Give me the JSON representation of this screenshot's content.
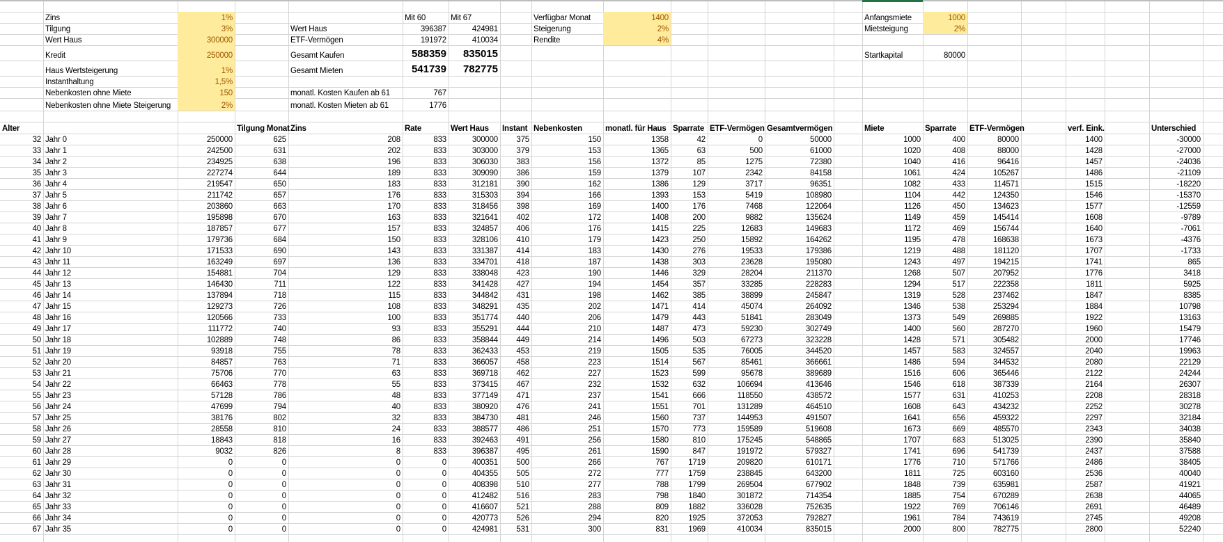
{
  "inputs": {
    "labels": [
      "Zins",
      "Tilgung",
      "Wert Haus",
      "Kredit",
      "Haus Wertsteigerung",
      "Instanthaltung",
      "Nebenkosten ohne Miete",
      "Nebenkosten ohne Miete Steigerung"
    ],
    "values": [
      "1%",
      "3%",
      "300000",
      "250000",
      "1%",
      "1,5%",
      "150",
      "2%"
    ]
  },
  "summary": {
    "col_mit60": "Mit 60",
    "col_mit67": "Mit 67",
    "rows": [
      {
        "label": "Wert Haus",
        "mit60": "396387",
        "mit67": "424981"
      },
      {
        "label": "ETF-Vermögen",
        "mit60": "191972",
        "mit67": "410034"
      },
      {
        "label": "Gesamt Kaufen",
        "mit60": "588359",
        "mit67": "835015"
      },
      {
        "label": "Gesamt Mieten",
        "mit60": "541739",
        "mit67": "782775"
      }
    ],
    "kosten_kaufen_label": "monatl. Kosten Kaufen ab 61",
    "kosten_kaufen": "767",
    "kosten_mieten_label": "monatl. Kosten Mieten ab 61",
    "kosten_mieten": "1776"
  },
  "sparen": {
    "labels": [
      "Verfügbar Monat",
      "Steigerung",
      "Rendite"
    ],
    "values": [
      "1400",
      "2%",
      "4%"
    ]
  },
  "miete": {
    "anfangsmiete_label": "Anfangsmiete",
    "anfangsmiete": "1000",
    "mietsteigung_label": "Mietsteigung",
    "mietsteigung": "2%",
    "startkapital_label": "Startkapital",
    "startkapital": "80000"
  },
  "table": {
    "headers": [
      "Alter",
      "",
      "",
      "Tilgung Monat",
      "Zins",
      "Rate",
      "Wert Haus",
      "Instant",
      "Nebenkosten",
      "monatl. für Haus",
      "Sparrate",
      "ETF-Vermögen",
      "Gesamtvermögen",
      "Miete",
      "Sparrate",
      "ETF-Vermögen",
      "verf. Eink.",
      "Unterschied"
    ],
    "rows": [
      [
        32,
        "Jahr 0",
        250000,
        625,
        208,
        833,
        300000,
        375,
        150,
        1358,
        42,
        0,
        50000,
        1000,
        400,
        80000,
        1400,
        -30000
      ],
      [
        33,
        "Jahr 1",
        242500,
        631,
        202,
        833,
        303000,
        379,
        153,
        1365,
        63,
        500,
        61000,
        1020,
        408,
        88000,
        1428,
        -27000
      ],
      [
        34,
        "Jahr 2",
        234925,
        638,
        196,
        833,
        306030,
        383,
        156,
        1372,
        85,
        1275,
        72380,
        1040,
        416,
        96416,
        1457,
        -24036
      ],
      [
        35,
        "Jahr 3",
        227274,
        644,
        189,
        833,
        309090,
        386,
        159,
        1379,
        107,
        2342,
        84158,
        1061,
        424,
        105267,
        1486,
        -21109
      ],
      [
        36,
        "Jahr 4",
        219547,
        650,
        183,
        833,
        312181,
        390,
        162,
        1386,
        129,
        3717,
        96351,
        1082,
        433,
        114571,
        1515,
        -18220
      ],
      [
        37,
        "Jahr 5",
        211742,
        657,
        176,
        833,
        315303,
        394,
        166,
        1393,
        153,
        5419,
        108980,
        1104,
        442,
        124350,
        1546,
        -15370
      ],
      [
        38,
        "Jahr 6",
        203860,
        663,
        170,
        833,
        318456,
        398,
        169,
        1400,
        176,
        7468,
        122064,
        1126,
        450,
        134623,
        1577,
        -12559
      ],
      [
        39,
        "Jahr 7",
        195898,
        670,
        163,
        833,
        321641,
        402,
        172,
        1408,
        200,
        9882,
        135624,
        1149,
        459,
        145414,
        1608,
        -9789
      ],
      [
        40,
        "Jahr 8",
        187857,
        677,
        157,
        833,
        324857,
        406,
        176,
        1415,
        225,
        12683,
        149683,
        1172,
        469,
        156744,
        1640,
        -7061
      ],
      [
        41,
        "Jahr 9",
        179736,
        684,
        150,
        833,
        328106,
        410,
        179,
        1423,
        250,
        15892,
        164262,
        1195,
        478,
        168638,
        1673,
        -4376
      ],
      [
        42,
        "Jahr 10",
        171533,
        690,
        143,
        833,
        331387,
        414,
        183,
        1430,
        276,
        19533,
        179386,
        1219,
        488,
        181120,
        1707,
        -1733
      ],
      [
        43,
        "Jahr 11",
        163249,
        697,
        136,
        833,
        334701,
        418,
        187,
        1438,
        303,
        23628,
        195080,
        1243,
        497,
        194215,
        1741,
        865
      ],
      [
        44,
        "Jahr 12",
        154881,
        704,
        129,
        833,
        338048,
        423,
        190,
        1446,
        329,
        28204,
        211370,
        1268,
        507,
        207952,
        1776,
        3418
      ],
      [
        45,
        "Jahr 13",
        146430,
        711,
        122,
        833,
        341428,
        427,
        194,
        1454,
        357,
        33285,
        228283,
        1294,
        517,
        222358,
        1811,
        5925
      ],
      [
        46,
        "Jahr 14",
        137894,
        718,
        115,
        833,
        344842,
        431,
        198,
        1462,
        385,
        38899,
        245847,
        1319,
        528,
        237462,
        1847,
        8385
      ],
      [
        47,
        "Jahr 15",
        129273,
        726,
        108,
        833,
        348291,
        435,
        202,
        1471,
        414,
        45074,
        264092,
        1346,
        538,
        253294,
        1884,
        10798
      ],
      [
        48,
        "Jahr 16",
        120566,
        733,
        100,
        833,
        351774,
        440,
        206,
        1479,
        443,
        51841,
        283049,
        1373,
        549,
        269885,
        1922,
        13163
      ],
      [
        49,
        "Jahr 17",
        111772,
        740,
        93,
        833,
        355291,
        444,
        210,
        1487,
        473,
        59230,
        302749,
        1400,
        560,
        287270,
        1960,
        15479
      ],
      [
        50,
        "Jahr 18",
        102889,
        748,
        86,
        833,
        358844,
        449,
        214,
        1496,
        503,
        67273,
        323228,
        1428,
        571,
        305482,
        2000,
        17746
      ],
      [
        51,
        "Jahr 19",
        93918,
        755,
        78,
        833,
        362433,
        453,
        219,
        1505,
        535,
        76005,
        344520,
        1457,
        583,
        324557,
        2040,
        19963
      ],
      [
        52,
        "Jahr 20",
        84857,
        763,
        71,
        833,
        366057,
        458,
        223,
        1514,
        567,
        85461,
        366661,
        1486,
        594,
        344532,
        2080,
        22129
      ],
      [
        53,
        "Jahr 21",
        75706,
        770,
        63,
        833,
        369718,
        462,
        227,
        1523,
        599,
        95678,
        389689,
        1516,
        606,
        365446,
        2122,
        24244
      ],
      [
        54,
        "Jahr 22",
        66463,
        778,
        55,
        833,
        373415,
        467,
        232,
        1532,
        632,
        106694,
        413646,
        1546,
        618,
        387339,
        2164,
        26307
      ],
      [
        55,
        "Jahr 23",
        57128,
        786,
        48,
        833,
        377149,
        471,
        237,
        1541,
        666,
        118550,
        438572,
        1577,
        631,
        410253,
        2208,
        28318
      ],
      [
        56,
        "Jahr 24",
        47699,
        794,
        40,
        833,
        380920,
        476,
        241,
        1551,
        701,
        131289,
        464510,
        1608,
        643,
        434232,
        2252,
        30278
      ],
      [
        57,
        "Jahr 25",
        38176,
        802,
        32,
        833,
        384730,
        481,
        246,
        1560,
        737,
        144953,
        491507,
        1641,
        656,
        459322,
        2297,
        32184
      ],
      [
        58,
        "Jahr 26",
        28558,
        810,
        24,
        833,
        388577,
        486,
        251,
        1570,
        773,
        159589,
        519608,
        1673,
        669,
        485570,
        2343,
        34038
      ],
      [
        59,
        "Jahr 27",
        18843,
        818,
        16,
        833,
        392463,
        491,
        256,
        1580,
        810,
        175245,
        548865,
        1707,
        683,
        513025,
        2390,
        35840
      ],
      [
        60,
        "Jahr 28",
        9032,
        826,
        8,
        833,
        396387,
        495,
        261,
        1590,
        847,
        191972,
        579327,
        1741,
        696,
        541739,
        2437,
        37588
      ],
      [
        61,
        "Jahr 29",
        0,
        0,
        0,
        0,
        400351,
        500,
        266,
        767,
        1719,
        209820,
        610171,
        1776,
        710,
        571766,
        2486,
        38405
      ],
      [
        62,
        "Jahr 30",
        0,
        0,
        0,
        0,
        404355,
        505,
        272,
        777,
        1759,
        238845,
        643200,
        1811,
        725,
        603160,
        2536,
        40040
      ],
      [
        63,
        "Jahr 31",
        0,
        0,
        0,
        0,
        408398,
        510,
        277,
        788,
        1799,
        269504,
        677902,
        1848,
        739,
        635981,
        2587,
        41921
      ],
      [
        64,
        "Jahr 32",
        0,
        0,
        0,
        0,
        412482,
        516,
        283,
        798,
        1840,
        301872,
        714354,
        1885,
        754,
        670289,
        2638,
        44065
      ],
      [
        65,
        "Jahr 33",
        0,
        0,
        0,
        0,
        416607,
        521,
        288,
        809,
        1882,
        336028,
        752635,
        1922,
        769,
        706146,
        2691,
        46489
      ],
      [
        66,
        "Jahr 34",
        0,
        0,
        0,
        0,
        420773,
        526,
        294,
        820,
        1925,
        372053,
        792827,
        1961,
        784,
        743619,
        2745,
        49208
      ],
      [
        67,
        "Jahr 35",
        0,
        0,
        0,
        0,
        424981,
        531,
        300,
        831,
        1969,
        410034,
        835015,
        2000,
        800,
        782775,
        2800,
        52240
      ]
    ]
  }
}
